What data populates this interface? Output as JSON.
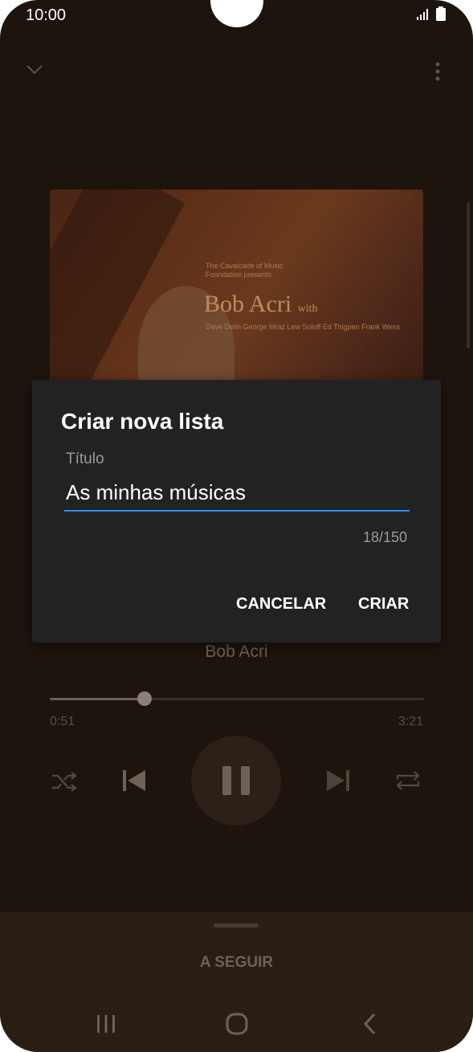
{
  "status_bar": {
    "time": "10:00"
  },
  "player": {
    "album_art": {
      "presenter_text": "The Cavalcade of Music Foundation presents",
      "title_text": "Bob Acri",
      "title_suffix": "with",
      "credits_text": "Dave Delin George Mraz Lew Soloff Ed Thigpen Frank Wess"
    },
    "artist": "Bob Acri",
    "elapsed": "0:51",
    "duration": "3:21",
    "progress_fraction": 0.254
  },
  "up_next": {
    "label": "A SEGUIR"
  },
  "dialog": {
    "title": "Criar nova lista",
    "field_label": "Título",
    "field_value": "As minhas músicas",
    "counter": "18/150",
    "cancel_label": "CANCELAR",
    "create_label": "CRIAR"
  },
  "colors": {
    "accent": "#2a8ff0",
    "dialog_bg": "#222222",
    "screen_bg": "#1d140d"
  }
}
